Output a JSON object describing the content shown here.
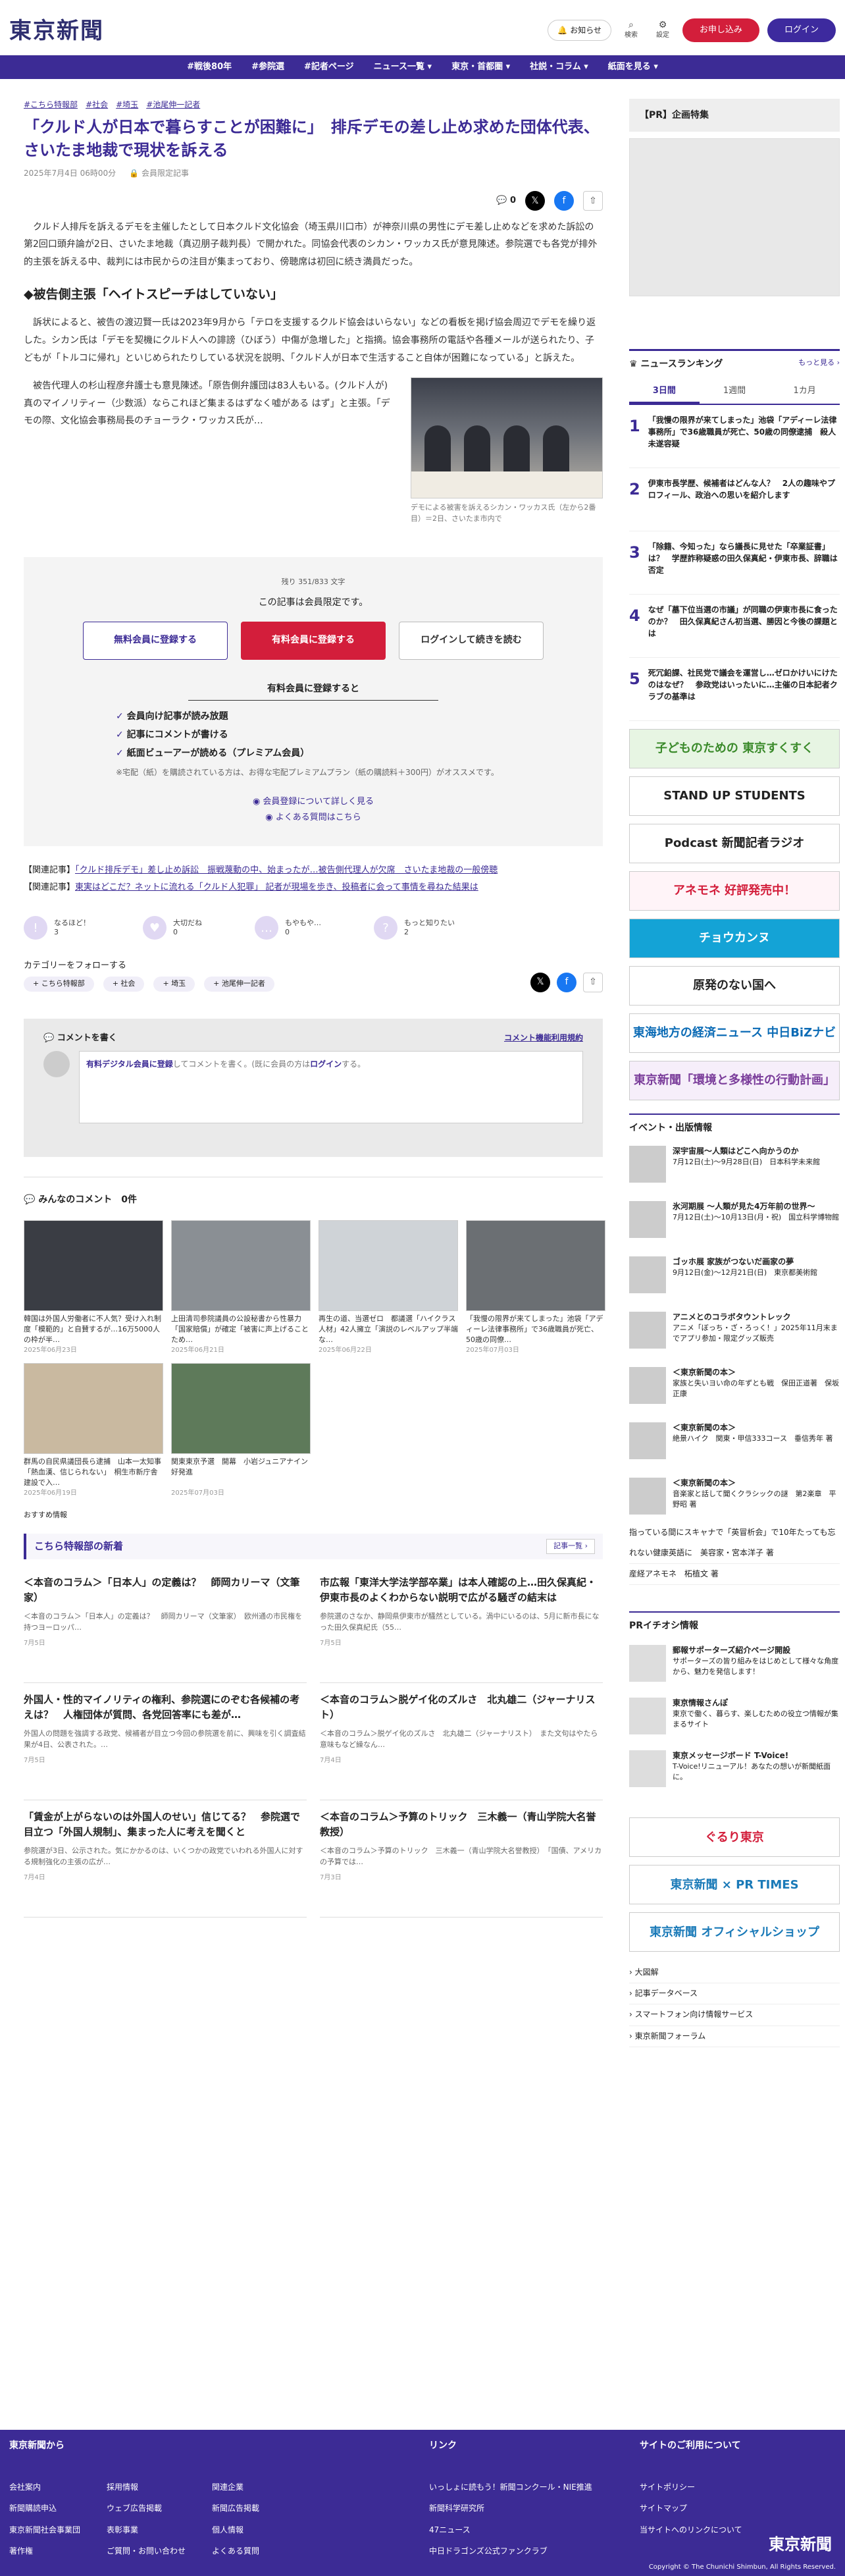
{
  "header": {
    "logo": "東京新聞",
    "notice_label": "お知らせ",
    "search_label": "検索",
    "settings_label": "設定",
    "apply_label": "お申し込み",
    "login_label": "ログイン"
  },
  "nav": {
    "items": [
      "#戦後80年",
      "#参院選",
      "#記者ページ",
      "ニュース一覧 ▾",
      "東京・首都圏 ▾",
      "社説・コラム ▾",
      "紙面を見る ▾"
    ]
  },
  "article": {
    "tags": [
      "#こちら特報部",
      "#社会",
      "#埼玉",
      "#池尾伸一記者"
    ],
    "title": "「クルド人が日本で暮らすことが困難に」　排斥デモの差し止め求めた団体代表、さいたま地裁で現状を訴える",
    "date": "2025年7月4日 06時00分",
    "member_limited": "会員限定記事",
    "comment_count": "0",
    "p1": "クルド人排斥を訴えるデモを主催したとして日本クルド文化協会（埼玉県川口市）が神奈川県の男性にデモ差し止めなどを求めた訴訟の第2回口頭弁論が2日、さいたま地裁（真辺朋子裁判長）で開かれた。同協会代表のシカン・ワッカス氏が意見陳述。参院選でも各党が排外的主張を訴える中、裁判には市民からの注目が集まっており、傍聴席は初回に続き満員だった。",
    "h2": "◆被告側主張「ヘイトスピーチはしていない」",
    "p2": "訴状によると、被告の渡辺賢一氏は2023年9月から「テロを支援するクルド協会はいらない」などの看板を掲げ協会周辺でデモを繰り返した。シカン氏は「デモを契機にクルド人への誹謗（ひぼう）中傷が急増した」と指摘。協会事務所の電話や各種メールが送られたり、子どもが「トルコに帰れ」といじめられたりしている状況を説明、「クルド人が日本で生活すること自体が困難になっている」と訴えた。",
    "p3": "被告代理人の杉山程彦弁護士も意見陳述。「原告側弁護団は83人もいる。(クルド人が) 真のマイノリティー（少数派）ならこれほど集まるはずなく嘘がある はず」と主張。「デモの際、文化協会事務局長のチョーラク・ワッカス氏が…",
    "caption": "デモによる被害を訴えるシカン・ワッカス氏（左から2番目）＝2日、さいたま市内で"
  },
  "paywall": {
    "remaining": "残り 351/833 文字",
    "title": "この記事は会員限定です。",
    "btn_free": "無料会員に登録する",
    "btn_paid": "有料会員に登録する",
    "btn_login": "ログインして続きを読む",
    "sub": "有料会員に登録すると",
    "benefits": [
      "会員向け記事が読み放題",
      "記事にコメントが書ける",
      "紙面ビューアーが読める（プレミアム会員）"
    ],
    "note": "※宅配（紙）を購読されている方は、お得な宅配プレミアムプラン（紙の購読料＋300円）がオススメです。",
    "link1": "◉ 会員登録について詳しく見る",
    "link2": "◉ よくある質問はこちら"
  },
  "related": [
    {
      "label": "【関連記事】",
      "text": "「クルド排斥デモ」差し止め訴訟　振戦蔑動の中、始まったが…被告側代理人が欠席　さいたま地裁の一般傍聴"
    },
    {
      "label": "【関連記事】",
      "text": "東実はどこだ？ネットに流れる「クルド人犯罪」 記者が現場を歩き、投稿者に会って事情を尋ねた結果は"
    }
  ],
  "reactions": [
    {
      "label": "なるほど！",
      "count": "3",
      "glyph": "!"
    },
    {
      "label": "大切だね",
      "count": "0",
      "glyph": "♥"
    },
    {
      "label": "もやもや…",
      "count": "0",
      "glyph": "…"
    },
    {
      "label": "もっと知りたい",
      "count": "2",
      "glyph": "?"
    }
  ],
  "follow": {
    "title": "カテゴリーをフォローする",
    "tags": [
      "+ こちら特報部",
      "+ 社会",
      "+ 埼玉",
      "+ 池尾伸一記者"
    ]
  },
  "comment_box": {
    "title": "コメントを書く",
    "rules": "コメント機能利用規約",
    "placeholder_link": "有料デジタル会員に登録",
    "placeholder_rest": "してコメントを書く。(既に会員の方は",
    "placeholder_login": "ログイン",
    "placeholder_end": "する。"
  },
  "comments_header": "みんなのコメント　0件",
  "thumbs": [
    {
      "title": "韓国は外国人労働者に不人気？受け入れ制度「模範的」と自賛するが…16万5000人の枠が半…",
      "date": "2025年06月23日"
    },
    {
      "title": "上田清司参院議員の公設秘書から性暴力「国家賠償」が確定「被害に声上げることため…",
      "date": "2025年06月21日"
    },
    {
      "title": "再生の道、当選ゼロ　都議選「ハイクラス人材」42人擁立「演説のレベルアップ半端な…",
      "date": "2025年06月22日"
    },
    {
      "title": "「我慢の限界が来てしまった」池袋「アディーレ法律事務所」で36歳職員が死亡、50歳の同僚…",
      "date": "2025年07月03日"
    },
    {
      "title": "群馬の自民県議団長ら逮捕　山本一太知事「熱血漢、信じられない」　桐生市新庁舎建設で入…",
      "date": "2025年06月19日"
    },
    {
      "title": "関東東京予選　開幕　小岩ジュニアナイン好発進",
      "date": "2025年07月03日"
    }
  ],
  "osusume": "おすすめ情報",
  "kokoban": {
    "title": "こちら特報部の新着",
    "more": "記事一覧 ›"
  },
  "news2": [
    {
      "title": "＜本音のコラム＞「日本人」の定義は？　師岡カリーマ（文筆家）",
      "desc": "＜本音のコラム＞「日本人」の定義は？　師岡カリーマ（文筆家）　欧州通の市民権を持つヨーロッパ…",
      "date": "7月5日"
    },
    {
      "title": "市広報「東洋大学法学部卒業」は本人確認の上…田久保真紀・伊東市長のよくわからない説明で広がる騒ぎの結末は",
      "desc": "参院選のさなか、静岡県伊東市が騒然としている。渦中にいるのは、5月に新市長になった田久保真紀氏（55…",
      "date": "7月5日"
    },
    {
      "title": "外国人・性的マイノリティの権利、参院選にのぞむ各候補の考えは？　人権団体が質問、各党回答率にも差が…",
      "desc": "外国人の問題を強調する政党、候補者が目立つ今回の参院選を前に、興味を引く調査結果が4日、公表された。…",
      "date": "7月5日"
    },
    {
      "title": "＜本音のコラム＞脱ゲイ化のズルさ　北丸雄二（ジャーナリスト）",
      "desc": "＜本音のコラム＞脱ゲイ化のズルさ　北丸雄二（ジャーナリスト）　また文句はやたら意味もなど繰なん…",
      "date": "7月4日"
    },
    {
      "title": "「賃金が上がらないのは外国人のせい」信じてる？　参院選で目立つ「外国人規制」、集まった人に考えを聞くと",
      "desc": "参院選が3日、公示された。気にかかるのは、いくつかの政党でいわれる外国人に対する規制強化の主張の広が…",
      "date": "7月4日"
    },
    {
      "title": "＜本音のコラム＞予算のトリック　三木義一（青山学院大名誉教授）",
      "desc": "＜本音のコラム＞予算のトリック　三木義一（青山学院大名誉教授）　「国債、アメリカの予算では…",
      "date": "7月3日"
    }
  ],
  "sidebar": {
    "pr_title": "【PR】企画特集",
    "ranking_title": "ニュースランキング",
    "ranking_more": "もっと見る ›",
    "tabs": [
      "3日間",
      "1週間",
      "1カ月"
    ],
    "ranking": [
      {
        "n": "1",
        "t": "「我慢の限界が来てしまった」池袋「アディーレ法律事務所」で36歳職員が死亡、50歳の同僚逮捕　殺人未遂容疑"
      },
      {
        "n": "2",
        "t": "伊東市長学歴、候補者はどんな人？　2人の趣味やプロフィール、政治への思いを紹介します"
      },
      {
        "n": "3",
        "t": "「除籍、今知った」なら議長に見せた「卒業証書」は？　学歴詐称疑惑の田久保真紀・伊東市長、辞職は否定"
      },
      {
        "n": "4",
        "t": "なぜ「墓下位当選の市議」が同職の伊東市長に食ったのか？　田久保真紀さん初当選、勝因と今後の課題とは"
      },
      {
        "n": "5",
        "t": "死冗鉛課、社民党で議会を運営し…ゼロかけいにけたのはなぜ？　参政党はいったいに…主催の日本記者クラブの基準は"
      }
    ],
    "banners": [
      {
        "text": "子どものための 東京すくすく",
        "bg": "#e7f5e3",
        "fg": "#3a8a2a"
      },
      {
        "text": "STAND UP STUDENTS",
        "bg": "#ffffff",
        "fg": "#222222"
      },
      {
        "text": "Podcast 新聞記者ラジオ",
        "bg": "#ffffff",
        "fg": "#222222"
      },
      {
        "text": "アネモネ 好評発売中！",
        "bg": "#fff4f8",
        "fg": "#d31e3b"
      },
      {
        "text": "チョウカンヌ",
        "bg": "#14a3d6",
        "fg": "#ffffff"
      },
      {
        "text": "原発のない国へ",
        "bg": "#ffffff",
        "fg": "#222222"
      },
      {
        "text": "東海地方の経済ニュース 中日BiZナビ",
        "bg": "#ffffff",
        "fg": "#0b6bb5"
      },
      {
        "text": "東京新聞「環境と多様性の行動計画」",
        "bg": "#f6eefa",
        "fg": "#7a3c9a"
      }
    ],
    "events_title": "イベント・出版情報",
    "events": [
      {
        "b": "深宇宙展〜人類はどこへ向かうのか",
        "t": "7月12日(土)〜9月28日(日)　日本科学未来館"
      },
      {
        "b": "氷河期展 〜人類が見た4万年前の世界〜",
        "t": "7月12日(土)〜10月13日(月・祝)　国立科学博物館"
      },
      {
        "b": "ゴッホ展 家族がつないだ画家の夢",
        "t": "9月12日(金)〜12月21日(日)　東京都美術館"
      },
      {
        "b": "アニメとのコラボタウントレック",
        "t": "アニメ「ぼっち・ざ・ろっく！」2025年11月末までアプリ参加・限定グッズ販売"
      },
      {
        "b": "＜東京新聞の本＞",
        "t": "家族と失いヨい命の年ずとも戦　保田正道著　保坂正康"
      },
      {
        "b": "＜東京新聞の本＞",
        "t": "絶景ハイク　関東・甲信333コース　垂信秀年 著"
      },
      {
        "b": "＜東京新聞の本＞",
        "t": "音楽家と話して聞くクラシックの謎　第2楽章　平野昭 著"
      }
    ],
    "events_links": [
      "指っている間にスキャナで「英冒析会」で10年たっても忘れない健康英語に　美容家・宮本洋子 著",
      "産経アネモネ　柘植文 著"
    ],
    "pr_info_title": "PRイチオシ情報",
    "pr_info": [
      {
        "b": "郵報サポーターズ紹介ページ開設",
        "t": "サポーターズの皆り組みをはじめとして様々な角度から、魅力を発信します！"
      },
      {
        "b": "東京情報さんぽ",
        "t": "東京で働く、暮らす、楽しむための役立つ情報が集まるサイト"
      },
      {
        "b": "東京メッセージボード T-Voice!",
        "t": "T-Voice!リニューアル！あなたの想いが新聞紙面に。"
      }
    ],
    "bottom_banners": [
      {
        "text": "ぐるり東京",
        "bg": "#ffffff",
        "fg": "#d31e3b"
      },
      {
        "text": "東京新聞 × PR TIMES",
        "bg": "#ffffff",
        "fg": "#1a7ab8"
      },
      {
        "text": "東京新聞 オフィシャルショップ",
        "bg": "#ffffff",
        "fg": "#1a7ab8"
      }
    ],
    "links": [
      "› 大図解",
      "› 記事データベース",
      "› スマートフォン向け情報サービス",
      "› 東京新聞フォーラム"
    ]
  },
  "footer": {
    "col1_title": "東京新聞から",
    "col1": [
      [
        "会社案内",
        "採用情報",
        "関連企業"
      ],
      [
        "新聞購読申込",
        "ウェブ広告掲載",
        "新聞広告掲載"
      ],
      [
        "東京新聞社会事業団",
        "表彰事業",
        "個人情報"
      ],
      [
        "著作権",
        "ご質問・お問い合わせ",
        "よくある質問"
      ]
    ],
    "col2_title": "リンク",
    "col2": [
      "いっしょに読もう！新聞コンクール・NIE推進",
      "新聞科学研究所",
      "47ニュース",
      "中日ドラゴンズ公式ファンクラブ"
    ],
    "col3_title": "サイトのご利用について",
    "col3": [
      "サイトポリシー",
      "サイトマップ",
      "当サイトへのリンクについて"
    ],
    "logo": "東京新聞",
    "copyright": "Copyright © The Chunichi Shimbun, All Rights Reserved."
  },
  "colors": {
    "brand": "#3c2b95",
    "accent": "#d31e3b"
  }
}
